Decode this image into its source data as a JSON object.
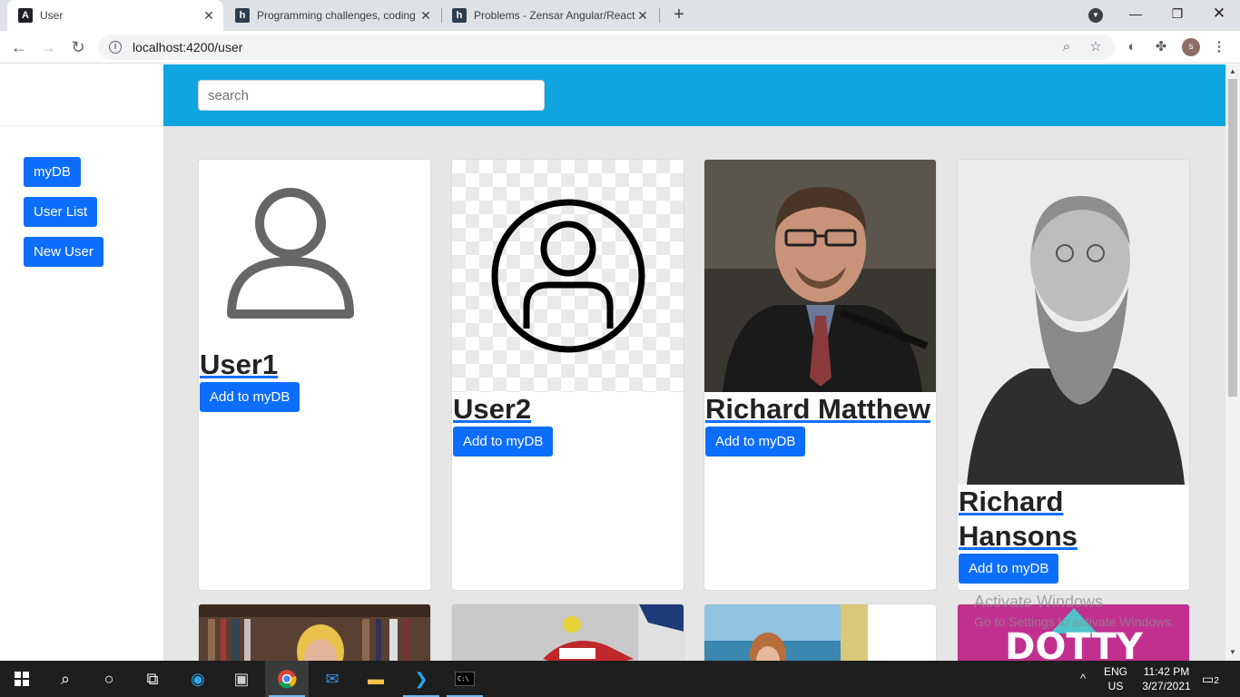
{
  "browser": {
    "tabs": [
      {
        "title": "User",
        "favicon": "A",
        "favicon_color": "#202124"
      },
      {
        "title": "Programming challenges, coding",
        "favicon": "h",
        "favicon_color": "#2c3e50"
      },
      {
        "title": "Problems - Zensar Angular/React",
        "favicon": "h",
        "favicon_color": "#2c3e50"
      }
    ],
    "url": "localhost:4200/user",
    "profile_initial": "s"
  },
  "sidebar": {
    "buttons": [
      "myDB",
      "User List",
      "New User"
    ]
  },
  "header": {
    "search_placeholder": "search"
  },
  "cards": [
    {
      "name": "User1",
      "button": "Add to myDB",
      "image": "person-outline-icon"
    },
    {
      "name": "User2",
      "button": "Add to myDB",
      "image": "user-circle-icon"
    },
    {
      "name": "Richard Matthew",
      "button": "Add to myDB",
      "image": "photo-man-speaking"
    },
    {
      "name": "Richard Hansons",
      "button": "Add to myDB",
      "image": "photo-bearded-man"
    }
  ],
  "second_row_images": [
    "photo-woman-books",
    "photo-skier",
    "photo-woman-beach",
    "photo-dotty-poster"
  ],
  "dotty_text": "DOTTY",
  "watermark": {
    "title": "Activate Windows",
    "subtitle": "Go to Settings to activate Windows."
  },
  "taskbar": {
    "language": "ENG",
    "region": "US",
    "time": "11:42 PM",
    "date": "3/27/2021",
    "notification_count": "2"
  },
  "colors": {
    "header_blue": "#0ea5e0",
    "button_blue": "#0d6efd",
    "page_bg": "#e6e6e6"
  }
}
